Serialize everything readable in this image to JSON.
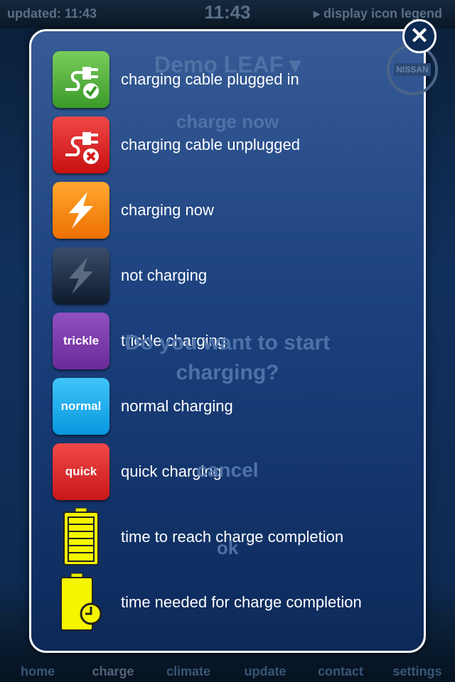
{
  "status": {
    "updated": "updated:  11:43",
    "clock": "11:43",
    "legend_link": "▸ display icon legend"
  },
  "background": {
    "vehicle": "Demo LEAF ▾",
    "charge_now": "charge now",
    "question": "Do you want to start charging?",
    "cancel": "cancel",
    "ok": "ok",
    "brand": "NISSAN"
  },
  "tabs": [
    "home",
    "charge",
    "climate",
    "update",
    "contact",
    "settings"
  ],
  "legend": {
    "close": "✕",
    "items": [
      {
        "icon": "plug-check-icon",
        "color": "#4caf3a",
        "label": "charging cable plugged in"
      },
      {
        "icon": "plug-x-icon",
        "color": "#e02020",
        "label": "charging cable unplugged"
      },
      {
        "icon": "lightning-icon",
        "color": "#f58a10",
        "label": "charging now"
      },
      {
        "icon": "lightning-dim-icon",
        "color": "#1a2e48",
        "label": "not charging"
      },
      {
        "icon": "trickle-icon",
        "color": "#7a3aa8",
        "label": "trickle charging",
        "text": "trickle"
      },
      {
        "icon": "normal-icon",
        "color": "#18a8e8",
        "label": "normal charging",
        "text": "normal"
      },
      {
        "icon": "quick-icon",
        "color": "#e02a2a",
        "label": "quick charging",
        "text": "quick"
      },
      {
        "icon": "battery-full-icon",
        "color": "#f5f500",
        "label": "time to reach charge completion"
      },
      {
        "icon": "battery-clock-icon",
        "color": "#f5f500",
        "label": "time needed for charge completion"
      }
    ]
  }
}
